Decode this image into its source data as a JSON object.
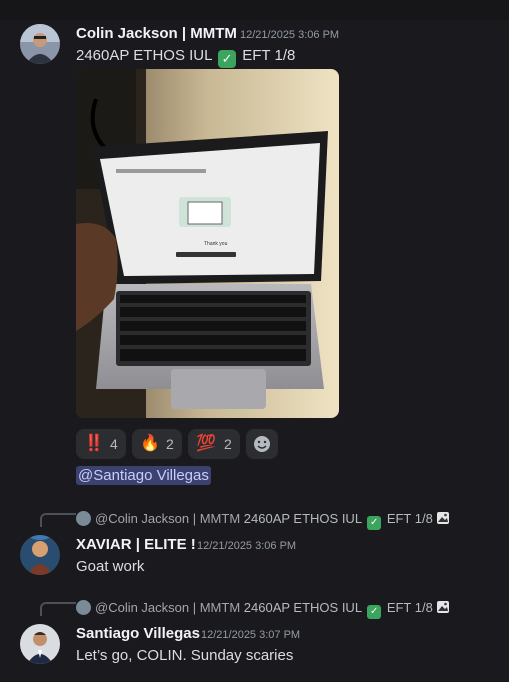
{
  "messages": [
    {
      "author": "Colin Jackson | MMTM",
      "timestamp": "12/21/2025 3:06 PM",
      "content_prefix": "2460AP ETHOS IUL",
      "content_check": "✓",
      "content_suffix": "EFT 1/8",
      "attachment_alt": "Photo of a laptop",
      "screen_text": {
        "title": "Thank you"
      },
      "reactions": [
        {
          "emoji": "‼️",
          "count": "4"
        },
        {
          "emoji": "🔥",
          "count": "2"
        },
        {
          "emoji": "💯",
          "count": "2"
        }
      ],
      "add_reaction_icon": "add-reaction-icon",
      "mention": "@Santiago Villegas"
    },
    {
      "reply_to": "@Colin Jackson | MMTM",
      "reply_snippet": "2460AP ETHOS IUL",
      "reply_suffix": "EFT 1/8",
      "reply_image_icon": "image-icon",
      "author": "XAVIAR | ELITE !",
      "timestamp": "12/21/2025 3:06 PM",
      "content": "Goat work"
    },
    {
      "reply_to": "@Colin Jackson | MMTM",
      "reply_snippet": "2460AP ETHOS IUL",
      "reply_suffix": "EFT 1/8",
      "reply_image_icon": "image-icon",
      "author": "Santiago Villegas",
      "timestamp": "12/21/2025 3:07 PM",
      "content": "Let’s go, COLIN. Sunday scaries"
    }
  ],
  "colors": {
    "background": "#1a1a1e",
    "mention_bg": "#3c4270",
    "check_green": "#3ba55d"
  }
}
